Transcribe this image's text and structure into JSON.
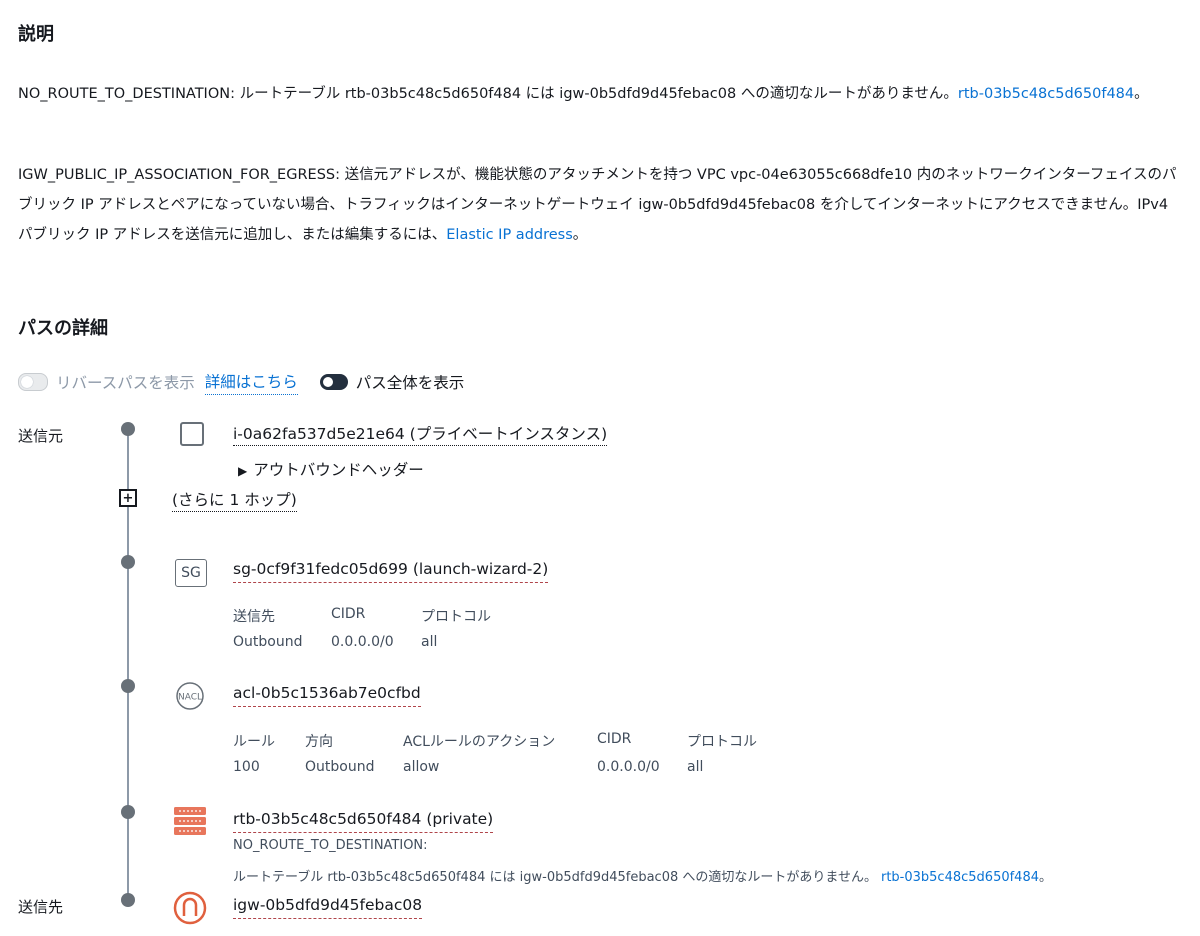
{
  "explanation": {
    "heading": "説明",
    "p1_code": "NO_ROUTE_TO_DESTINATION:",
    "p1_text": " ルートテーブル rtb-03b5c48c5d650f484 には igw-0b5dfd9d45febac08 への適切なルートがありません。",
    "p1_link": "rtb-03b5c48c5d650f484",
    "p1_end": "。",
    "p2_code": "IGW_PUBLIC_IP_ASSOCIATION_FOR_EGRESS:",
    "p2_text": " 送信元アドレスが、機能状態のアタッチメントを持つ VPC vpc-04e63055c668dfe10 内のネットワークインターフェイスのパブリック IP アドレスとペアになっていない場合、トラフィックはインターネットゲートウェイ igw-0b5dfd9d45febac08 を介してインターネットにアクセスできません。IPv4 パブリック IP アドレスを送信元に追加し、または編集するには、",
    "p2_link": "Elastic IP address",
    "p2_end": "。"
  },
  "path": {
    "heading": "パスの詳細",
    "toggle_reverse_label": "リバースパスを表示",
    "learn_more": "詳細はこちら",
    "toggle_full_label": "パス全体を表示",
    "source_label": "送信元",
    "dest_label": "送信先",
    "instance": "i-0a62fa537d5e21e64 (プライベートインスタンス)",
    "outbound_header": "アウトバウンドヘッダー",
    "more_hops": "(さらに 1 ホップ)",
    "sg": {
      "icon_text": "SG",
      "id": "sg-0cf9f31fedc05d699 (launch-wizard-2)",
      "headers": [
        "送信先",
        "CIDR",
        "プロトコル"
      ],
      "row": [
        "Outbound",
        "0.0.0.0/0",
        "all"
      ]
    },
    "acl": {
      "icon_text": "NACL",
      "id": "acl-0b5c1536ab7e0cfbd",
      "headers": [
        "ルール",
        "方向",
        "ACLルールのアクション",
        "CIDR",
        "プロトコル"
      ],
      "row": [
        "100",
        "Outbound",
        "allow",
        "0.0.0.0/0",
        "all"
      ]
    },
    "rtb": {
      "id": "rtb-03b5c48c5d650f484 (private)",
      "code": "NO_ROUTE_TO_DESTINATION:",
      "text": "ルートテーブル rtb-03b5c48c5d650f484 には igw-0b5dfd9d45febac08 への適切なルートがありません。",
      "link": "rtb-03b5c48c5d650f484",
      "end": "。"
    },
    "igw": {
      "id": "igw-0b5dfd9d45febac08"
    }
  },
  "colors": {
    "link": "#0972d3",
    "route_table_icon": "#e8765c",
    "igw_icon": "#e0603e",
    "node": "#687078"
  }
}
